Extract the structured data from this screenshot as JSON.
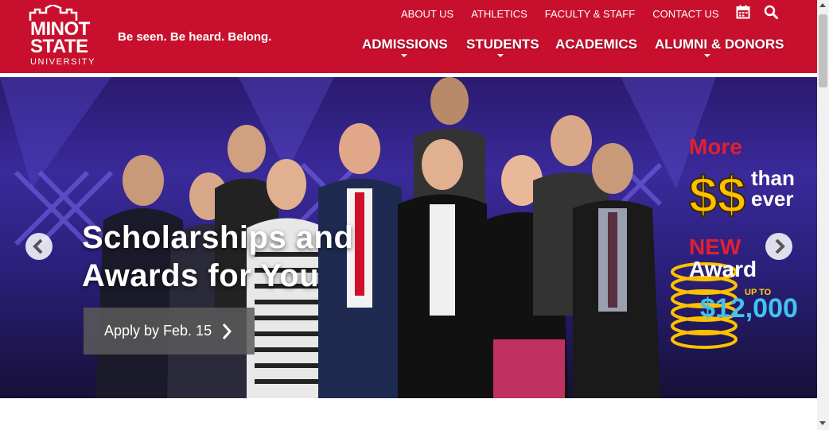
{
  "brand": {
    "logo_line1": "MINOT",
    "logo_line2": "STATE",
    "logo_line3": "UNIVERSITY",
    "tagline": "Be seen. Be heard. Belong.",
    "primary_color": "#c8102e"
  },
  "utility_nav": {
    "items": [
      {
        "label": "ABOUT US"
      },
      {
        "label": "ATHLETICS"
      },
      {
        "label": "FACULTY & STAFF"
      },
      {
        "label": "CONTACT US"
      }
    ],
    "calendar_icon": "calendar-icon",
    "search_icon": "search-icon"
  },
  "main_nav": {
    "items": [
      {
        "label": "ADMISSIONS",
        "has_dropdown": true
      },
      {
        "label": "STUDENTS",
        "has_dropdown": true
      },
      {
        "label": "ACADEMICS",
        "has_dropdown": false
      },
      {
        "label": "ALUMNI & DONORS",
        "has_dropdown": true
      }
    ]
  },
  "hero": {
    "title_line1": "Scholarships and",
    "title_line2": "Awards for You",
    "cta_label": "Apply by Feb. 15",
    "prev_icon": "chevron-left-icon",
    "next_icon": "chevron-right-icon",
    "promo": {
      "more": "More",
      "than": "than",
      "ever": "ever",
      "new": "NEW",
      "award": "Award",
      "up_to": "UP TO",
      "amount": "$12,000"
    }
  }
}
